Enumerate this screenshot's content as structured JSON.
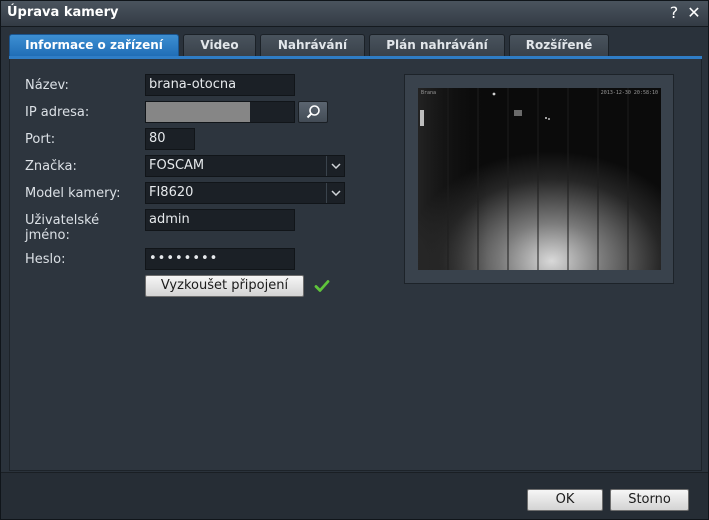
{
  "window": {
    "title": "Úprava kamery"
  },
  "titlebar": {
    "help_label": "?",
    "close_label": "✕"
  },
  "tabs": [
    {
      "label": "Informace o zařízení",
      "active": true
    },
    {
      "label": "Video",
      "active": false
    },
    {
      "label": "Nahrávání",
      "active": false
    },
    {
      "label": "Plán nahrávání",
      "active": false
    },
    {
      "label": "Rozšířené",
      "active": false
    }
  ],
  "form": {
    "name": {
      "label": "Název:",
      "value": "brana-otocna"
    },
    "ip": {
      "label": "IP adresa:",
      "value": ""
    },
    "port": {
      "label": "Port:",
      "value": "80"
    },
    "brand": {
      "label": "Značka:",
      "value": "FOSCAM"
    },
    "model": {
      "label": "Model kamery:",
      "value": "FI8620"
    },
    "username": {
      "label_line1": "Uživatelské",
      "label_line2": "jméno:",
      "value": "admin"
    },
    "password": {
      "label": "Heslo:",
      "value": "••••••••"
    },
    "test_button": "Vyzkoušet připojení"
  },
  "preview": {
    "camera_label": "Brana",
    "timestamp": "2013-12-30 20:58:10"
  },
  "footer": {
    "ok_label": "OK",
    "cancel_label": "Storno"
  },
  "colors": {
    "accent": "#2f7dc6",
    "success": "#5fc43b"
  }
}
